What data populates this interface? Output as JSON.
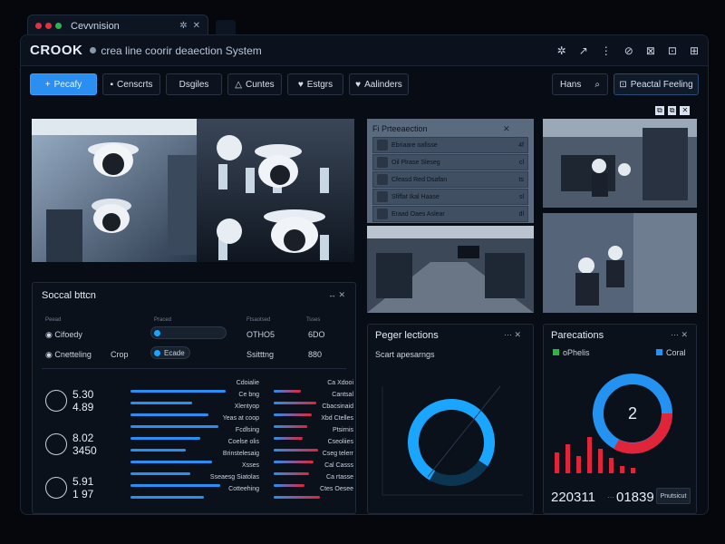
{
  "browser": {
    "tab_title": "Cevvnision",
    "tab_icon_a": "✲",
    "tab_close": "✕"
  },
  "header": {
    "brand": "CROOK",
    "url_text": "crea line coorir deaection System",
    "tool_icons": [
      "✲",
      "↗",
      "⋮",
      "⊘",
      "⊠",
      "⊡",
      "⊞"
    ]
  },
  "nav": {
    "items": [
      {
        "icon": "+",
        "label": "Pecafy"
      },
      {
        "icon": "▪",
        "label": "Censcrts"
      },
      {
        "icon": "",
        "label": "Dsgiles"
      },
      {
        "icon": "△",
        "label": "Cuntes"
      },
      {
        "icon": "♥",
        "label": "Estgrs"
      },
      {
        "icon": "♥",
        "label": "Aalinders"
      }
    ],
    "right_field": "Hans",
    "right_button": "Peactal Feeling"
  },
  "detection_list": {
    "title": "Fi Prteeaection",
    "close": "✕",
    "items": [
      {
        "label": "Ebriaare oafisse",
        "val": "4f"
      },
      {
        "label": "Oil Plrase Sleseg",
        "val": "cl"
      },
      {
        "label": "Cfeasd Red Dsafan",
        "val": "ts"
      },
      {
        "label": "Sfiffat Ikal Haase",
        "val": "sl"
      },
      {
        "label": "Eraad Oaes Aslear",
        "val": "dl"
      }
    ]
  },
  "small_controls": [
    "⧉",
    "⧉",
    "✕"
  ],
  "social": {
    "title": "Soccal bttcn",
    "ctrl": "↔ ✕",
    "col_heads": [
      "Peead",
      "Praced",
      "Ftsaotsed",
      "Tsses"
    ],
    "row1": {
      "name": "Cifoedy",
      "field_value": "",
      "col3": "OTHO5",
      "col4": "6DO"
    },
    "row2": {
      "name": "Cnetteling",
      "extra": "Crop",
      "field_value": "Ecade",
      "col3": "Ssitttng",
      "col4": "880"
    },
    "stat_groups": [
      {
        "top": "5.30",
        "bottom": "4.89"
      },
      {
        "top": "8.02",
        "bottom": "3450"
      },
      {
        "top": "5.91",
        "bottom": "1 97"
      }
    ],
    "mid_labels": [
      "Cdoialie",
      "Ce bng",
      "Xlentyop",
      "Yeas at coop",
      "Fcdlsing",
      "Coelse olis",
      "Brinstelesaig",
      "Xsses",
      "Sseaesg Siatolas",
      "Cotteehing"
    ],
    "right_labels": [
      "Ca Xdooi",
      "Cantsal",
      "Cbacsinaid",
      "Xbd Ctelles",
      "Ptsirnis",
      "Cseoliies",
      "Cseg telerr",
      "Cal Casss",
      "Ca rtasse",
      "Ctes Oesee"
    ]
  },
  "performance": {
    "title": "Peger lections",
    "ctrl": "⋯ ✕",
    "subtitle": "Scart apesarngs",
    "gauge_color": "#1aa6ff"
  },
  "parcations": {
    "title": "Parecations",
    "ctrl": "⋯ ✕",
    "legend_left": "oPhelis",
    "legend_right": "Coral",
    "donut_value": "2",
    "num_left": "220311",
    "num_mid": "01839",
    "button": "Pnutsicut",
    "colors": {
      "blue": "#2392f0",
      "red": "#e0243a",
      "green": "#2fb24a"
    },
    "bar_values": [
      0.55,
      0.75,
      0.45,
      0.95,
      0.65,
      0.4,
      0.2,
      0.15
    ]
  }
}
